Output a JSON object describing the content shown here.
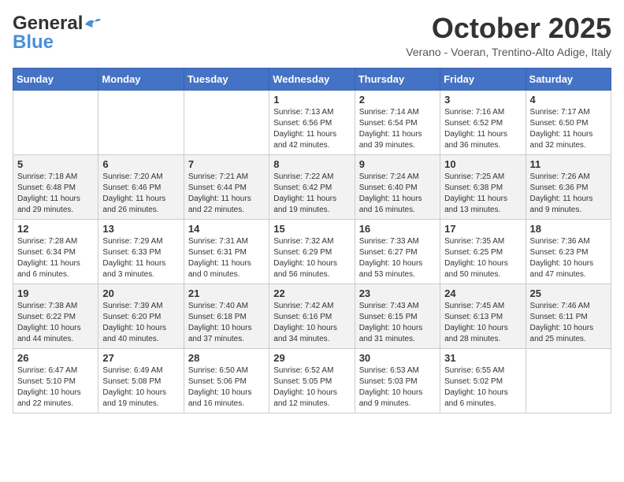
{
  "header": {
    "logo_general": "General",
    "logo_blue": "Blue",
    "month_title": "October 2025",
    "location": "Verano - Voeran, Trentino-Alto Adige, Italy"
  },
  "days_of_week": [
    "Sunday",
    "Monday",
    "Tuesday",
    "Wednesday",
    "Thursday",
    "Friday",
    "Saturday"
  ],
  "weeks": [
    [
      {
        "day": "",
        "info": ""
      },
      {
        "day": "",
        "info": ""
      },
      {
        "day": "",
        "info": ""
      },
      {
        "day": "1",
        "info": "Sunrise: 7:13 AM\nSunset: 6:56 PM\nDaylight: 11 hours and 42 minutes."
      },
      {
        "day": "2",
        "info": "Sunrise: 7:14 AM\nSunset: 6:54 PM\nDaylight: 11 hours and 39 minutes."
      },
      {
        "day": "3",
        "info": "Sunrise: 7:16 AM\nSunset: 6:52 PM\nDaylight: 11 hours and 36 minutes."
      },
      {
        "day": "4",
        "info": "Sunrise: 7:17 AM\nSunset: 6:50 PM\nDaylight: 11 hours and 32 minutes."
      }
    ],
    [
      {
        "day": "5",
        "info": "Sunrise: 7:18 AM\nSunset: 6:48 PM\nDaylight: 11 hours and 29 minutes."
      },
      {
        "day": "6",
        "info": "Sunrise: 7:20 AM\nSunset: 6:46 PM\nDaylight: 11 hours and 26 minutes."
      },
      {
        "day": "7",
        "info": "Sunrise: 7:21 AM\nSunset: 6:44 PM\nDaylight: 11 hours and 22 minutes."
      },
      {
        "day": "8",
        "info": "Sunrise: 7:22 AM\nSunset: 6:42 PM\nDaylight: 11 hours and 19 minutes."
      },
      {
        "day": "9",
        "info": "Sunrise: 7:24 AM\nSunset: 6:40 PM\nDaylight: 11 hours and 16 minutes."
      },
      {
        "day": "10",
        "info": "Sunrise: 7:25 AM\nSunset: 6:38 PM\nDaylight: 11 hours and 13 minutes."
      },
      {
        "day": "11",
        "info": "Sunrise: 7:26 AM\nSunset: 6:36 PM\nDaylight: 11 hours and 9 minutes."
      }
    ],
    [
      {
        "day": "12",
        "info": "Sunrise: 7:28 AM\nSunset: 6:34 PM\nDaylight: 11 hours and 6 minutes."
      },
      {
        "day": "13",
        "info": "Sunrise: 7:29 AM\nSunset: 6:33 PM\nDaylight: 11 hours and 3 minutes."
      },
      {
        "day": "14",
        "info": "Sunrise: 7:31 AM\nSunset: 6:31 PM\nDaylight: 11 hours and 0 minutes."
      },
      {
        "day": "15",
        "info": "Sunrise: 7:32 AM\nSunset: 6:29 PM\nDaylight: 10 hours and 56 minutes."
      },
      {
        "day": "16",
        "info": "Sunrise: 7:33 AM\nSunset: 6:27 PM\nDaylight: 10 hours and 53 minutes."
      },
      {
        "day": "17",
        "info": "Sunrise: 7:35 AM\nSunset: 6:25 PM\nDaylight: 10 hours and 50 minutes."
      },
      {
        "day": "18",
        "info": "Sunrise: 7:36 AM\nSunset: 6:23 PM\nDaylight: 10 hours and 47 minutes."
      }
    ],
    [
      {
        "day": "19",
        "info": "Sunrise: 7:38 AM\nSunset: 6:22 PM\nDaylight: 10 hours and 44 minutes."
      },
      {
        "day": "20",
        "info": "Sunrise: 7:39 AM\nSunset: 6:20 PM\nDaylight: 10 hours and 40 minutes."
      },
      {
        "day": "21",
        "info": "Sunrise: 7:40 AM\nSunset: 6:18 PM\nDaylight: 10 hours and 37 minutes."
      },
      {
        "day": "22",
        "info": "Sunrise: 7:42 AM\nSunset: 6:16 PM\nDaylight: 10 hours and 34 minutes."
      },
      {
        "day": "23",
        "info": "Sunrise: 7:43 AM\nSunset: 6:15 PM\nDaylight: 10 hours and 31 minutes."
      },
      {
        "day": "24",
        "info": "Sunrise: 7:45 AM\nSunset: 6:13 PM\nDaylight: 10 hours and 28 minutes."
      },
      {
        "day": "25",
        "info": "Sunrise: 7:46 AM\nSunset: 6:11 PM\nDaylight: 10 hours and 25 minutes."
      }
    ],
    [
      {
        "day": "26",
        "info": "Sunrise: 6:47 AM\nSunset: 5:10 PM\nDaylight: 10 hours and 22 minutes."
      },
      {
        "day": "27",
        "info": "Sunrise: 6:49 AM\nSunset: 5:08 PM\nDaylight: 10 hours and 19 minutes."
      },
      {
        "day": "28",
        "info": "Sunrise: 6:50 AM\nSunset: 5:06 PM\nDaylight: 10 hours and 16 minutes."
      },
      {
        "day": "29",
        "info": "Sunrise: 6:52 AM\nSunset: 5:05 PM\nDaylight: 10 hours and 12 minutes."
      },
      {
        "day": "30",
        "info": "Sunrise: 6:53 AM\nSunset: 5:03 PM\nDaylight: 10 hours and 9 minutes."
      },
      {
        "day": "31",
        "info": "Sunrise: 6:55 AM\nSunset: 5:02 PM\nDaylight: 10 hours and 6 minutes."
      },
      {
        "day": "",
        "info": ""
      }
    ]
  ]
}
